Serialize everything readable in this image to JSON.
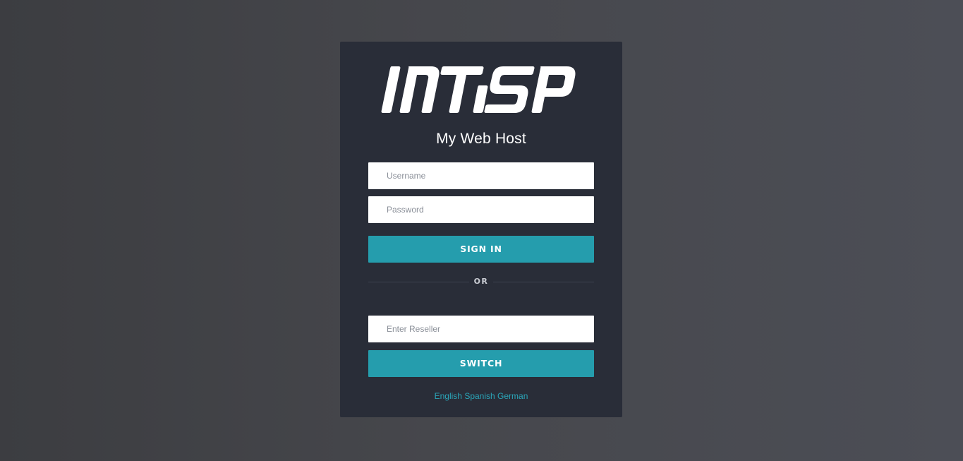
{
  "logo": {
    "text": "INTISP",
    "color": "#ffffff"
  },
  "site_title": "My Web Host",
  "login": {
    "username_placeholder": "Username",
    "password_placeholder": "Password",
    "sign_in_label": "SIGN IN"
  },
  "divider_label": "OR",
  "reseller": {
    "placeholder": "Enter Reseller",
    "switch_label": "SWITCH"
  },
  "languages": [
    {
      "label": "English"
    },
    {
      "label": "Spanish"
    },
    {
      "label": "German"
    }
  ],
  "colors": {
    "panel": "#292d38",
    "accent": "#259dad",
    "link": "#2aa5b8"
  }
}
